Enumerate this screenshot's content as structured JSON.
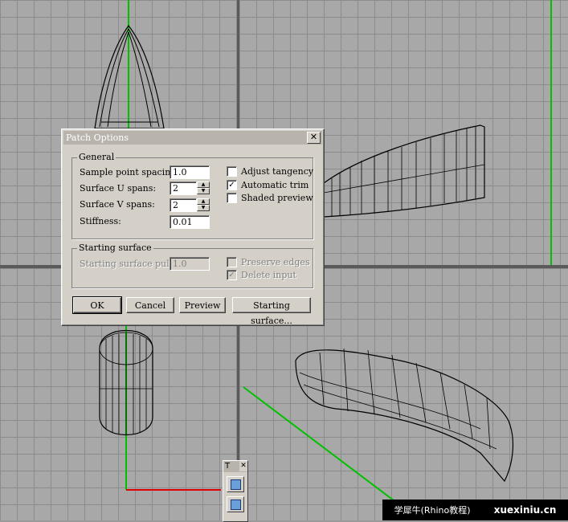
{
  "dialog": {
    "title": "Patch Options",
    "close_icon": "close-icon",
    "general": {
      "label": "General",
      "sample_point_spacing": {
        "label": "Sample point spacing:",
        "value": "1.0"
      },
      "surface_u_spans": {
        "label": "Surface U spans:",
        "value": "2"
      },
      "surface_v_spans": {
        "label": "Surface V spans:",
        "value": "2"
      },
      "stiffness": {
        "label": "Stiffness:",
        "value": "0.01"
      },
      "adjust_tangency": {
        "label": "Adjust tangency",
        "checked": false
      },
      "automatic_trim": {
        "label": "Automatic trim",
        "checked": true
      },
      "shaded_preview": {
        "label": "Shaded preview",
        "checked": false
      }
    },
    "starting_surface": {
      "label": "Starting surface",
      "pull": {
        "label": "Starting surface pull:",
        "value": "1.0"
      },
      "preserve_edges": {
        "label": "Preserve edges",
        "checked": false
      },
      "delete_input": {
        "label": "Delete input",
        "checked": true
      }
    },
    "buttons": {
      "ok": "OK",
      "cancel": "Cancel",
      "preview": "Preview",
      "starting_surface": "Starting surface..."
    }
  },
  "toolbar": {
    "title": "T",
    "close_label": "✕"
  },
  "watermark": {
    "text": "学犀牛(Rhino教程)",
    "url": "xuexiniu.cn"
  },
  "colors": {
    "viewport_bg": "#a8a8a8",
    "grid_line": "#8c8c8c",
    "axis_green": "#00c000",
    "axis_red": "#e00000",
    "wire": "#000000"
  }
}
